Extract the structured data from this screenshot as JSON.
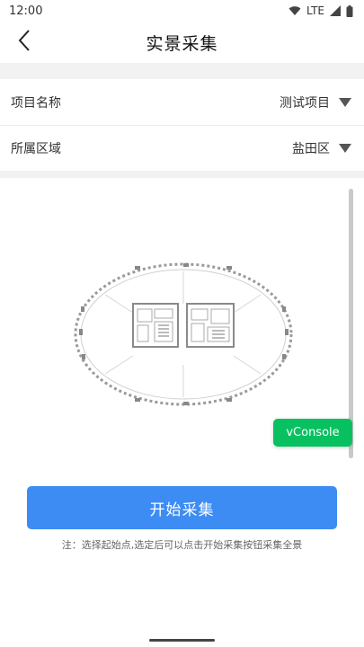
{
  "status_bar": {
    "time": "12:00",
    "network": "LTE",
    "icons": [
      "wifi-icon",
      "signal-icon",
      "battery-icon"
    ]
  },
  "header": {
    "title": "实景采集",
    "back_icon": "chevron-left-icon"
  },
  "form": {
    "project_label": "项目名称",
    "project_value": "测试项目",
    "area_label": "所属区域",
    "area_value": "盐田区",
    "dropdown_icon": "triangle-down-icon"
  },
  "floor_plan": {
    "icon": "floor-plan-image"
  },
  "vconsole": {
    "label": "vConsole",
    "color": "#07c160"
  },
  "actions": {
    "start_label": "开始采集",
    "accent": "#3d8cf4"
  },
  "note": "注：选择起始点,选定后可以点击开始采集按钮采集全景"
}
